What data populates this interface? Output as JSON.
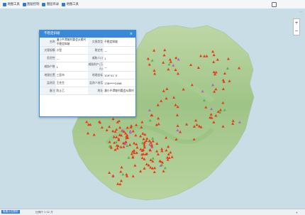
{
  "toolbar": {
    "items": [
      {
        "icon": "dolphin-icon",
        "label": "地图工具"
      },
      {
        "icon": "layers-icon",
        "label": "图层控制"
      },
      {
        "icon": "grid-icon",
        "label": "图层目录"
      },
      {
        "icon": "plot-icon",
        "label": "地图工具"
      }
    ]
  },
  "zoom": {
    "plus": "+",
    "minus": "−",
    "label": "..."
  },
  "popup": {
    "title": "不稳定斜坡",
    "close": "×",
    "rows": [
      {
        "k1": "名称",
        "v1": "潘小乡潭坡村委会从属村不稳定斜坡",
        "k2": "灾害类型",
        "v2": "不稳定斜坡"
      },
      {
        "k1": "灾害规模",
        "v1": "小型",
        "k2": "稳定性",
        "v2": "—"
      },
      {
        "k1": "危险性",
        "v1": "—",
        "k2": "威胁人口",
        "v2": "1"
      },
      {
        "k1": "威胁户数",
        "v1": "1",
        "k2": "威胁财产(万元)",
        "v2": "—"
      },
      {
        "k1": "地理位置",
        "v1": "三亚市",
        "k2": "地理坐标",
        "v2": "109°41′ E"
      },
      {
        "k1": "监测员",
        "v1": "王先生",
        "k2": "监测人电话",
        "v2": "138****2468"
      },
      {
        "k1": "备注",
        "v1": "防止乙",
        "k2": "地址",
        "v2": "潘小乡潭坡村委会从属村"
      }
    ]
  },
  "footer": {
    "link": "隐患点位图例",
    "text": "比例尺 1:32 万",
    "scale": "+"
  },
  "markers": {
    "red_color": "#e83b17",
    "green_color": "#59b34a",
    "purple_color": "#b25fd1"
  }
}
